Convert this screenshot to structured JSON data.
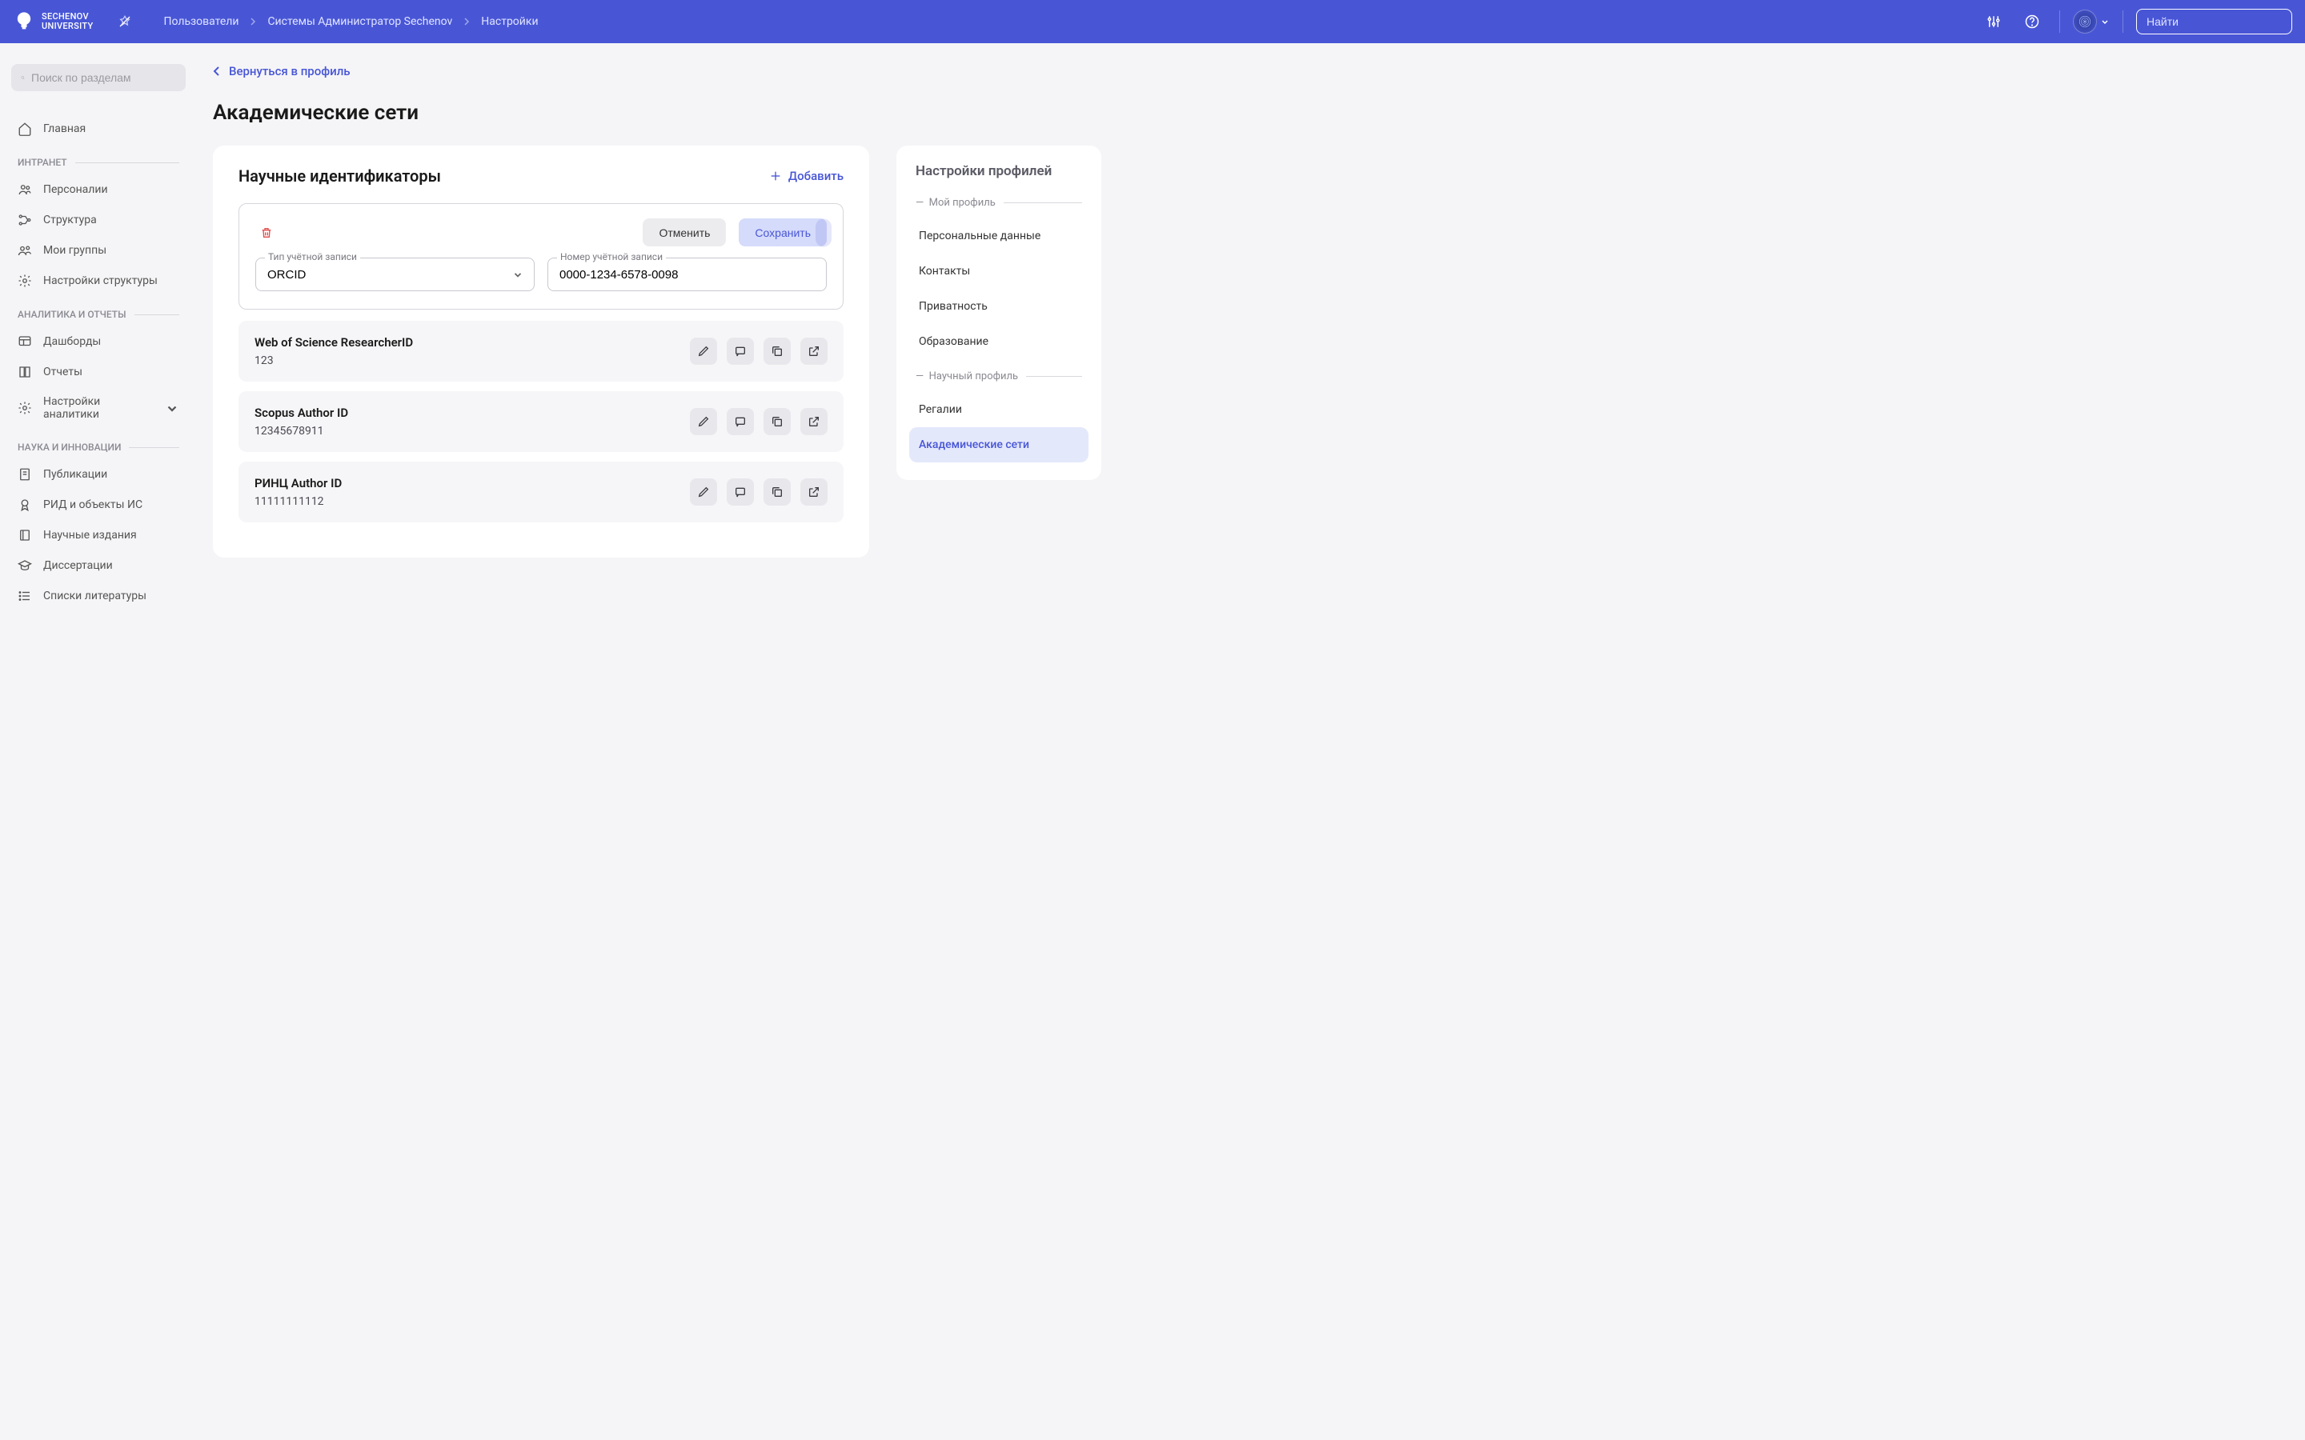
{
  "header": {
    "logo_line1": "SECHENOV",
    "logo_line2": "UNIVERSITY",
    "breadcrumb": [
      "Пользователи",
      "Системы Администратор Sechenov",
      "Настройки"
    ],
    "search_placeholder": "Найти"
  },
  "sidebar": {
    "search_placeholder": "Поиск по разделам",
    "home": "Главная",
    "sections": [
      {
        "label": "ИНТРАНЕТ",
        "items": [
          "Персоналии",
          "Структура",
          "Мои группы",
          "Настройки структуры"
        ]
      },
      {
        "label": "АНАЛИТИКА И ОТЧЕТЫ",
        "items": [
          "Дашборды",
          "Отчеты",
          "Настройки аналитики"
        ]
      },
      {
        "label": "НАУКА И ИННОВАЦИИ",
        "items": [
          "Публикации",
          "РИД и объекты ИС",
          "Научные издания",
          "Диссертации",
          "Списки литературы"
        ]
      }
    ]
  },
  "main": {
    "back_label": "Вернуться в профиль",
    "page_title": "Академические сети",
    "card_title": "Научные идентификаторы",
    "add_label": "Добавить",
    "edit": {
      "cancel": "Отменить",
      "save": "Сохранить",
      "type_label": "Тип учётной записи",
      "type_value": "ORCID",
      "number_label": "Номер учётной записи",
      "number_value": "0000-1234-6578-0098"
    },
    "ids": [
      {
        "name": "Web of Science ResearcherID",
        "value": "123"
      },
      {
        "name": "Scopus Author ID",
        "value": "12345678911"
      },
      {
        "name": "РИНЦ Author ID",
        "value": "11111111112"
      }
    ]
  },
  "right_panel": {
    "title": "Настройки профилей",
    "sections": [
      {
        "label": "Мой профиль",
        "items": [
          "Персональные данные",
          "Контакты",
          "Приватность",
          "Образование"
        ]
      },
      {
        "label": "Научный профиль",
        "items": [
          "Регалии",
          "Академические сети"
        ]
      }
    ],
    "active": "Академические сети"
  }
}
